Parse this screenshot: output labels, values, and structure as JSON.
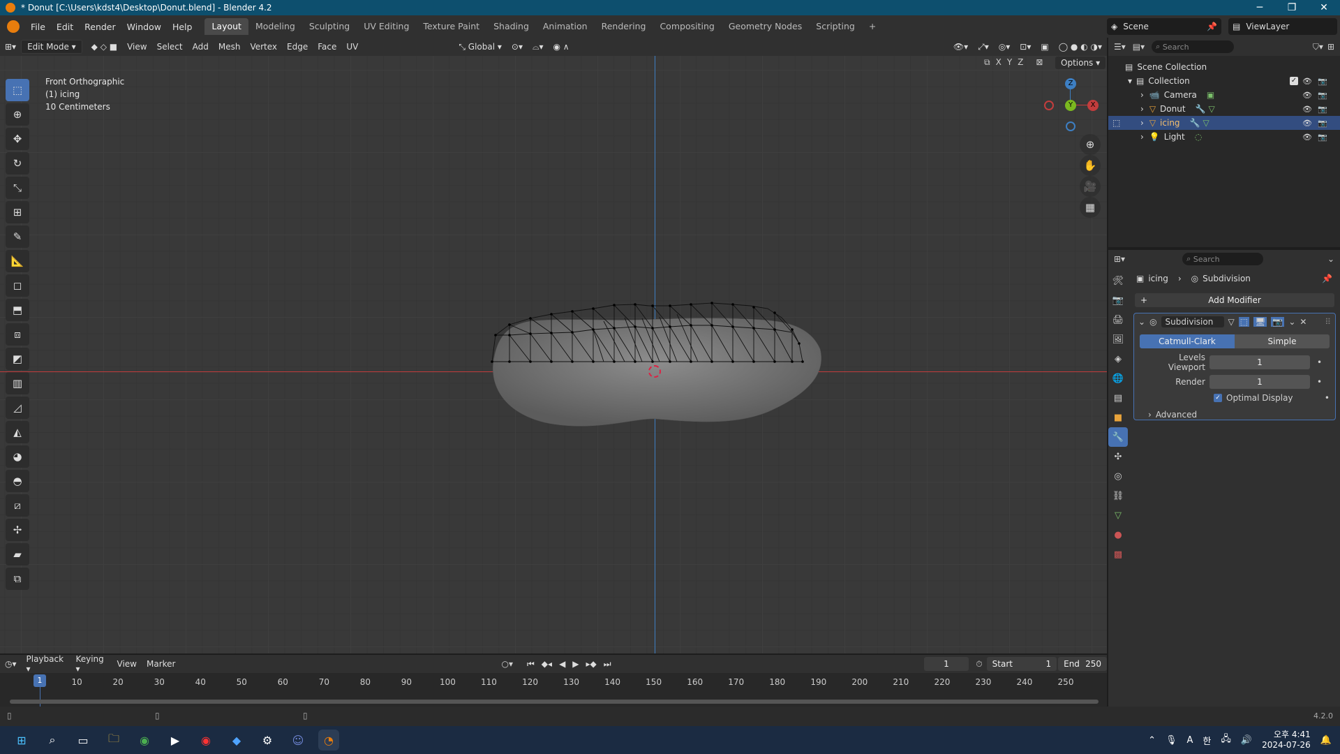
{
  "window": {
    "title": "* Donut [C:\\Users\\kdst4\\Desktop\\Donut.blend] - Blender 4.2",
    "minimize": "─",
    "restore": "❐",
    "close": "✕"
  },
  "menu": [
    "File",
    "Edit",
    "Render",
    "Window",
    "Help"
  ],
  "workspaces": [
    {
      "label": "Layout",
      "active": true
    },
    {
      "label": "Modeling"
    },
    {
      "label": "Sculpting"
    },
    {
      "label": "UV Editing"
    },
    {
      "label": "Texture Paint"
    },
    {
      "label": "Shading"
    },
    {
      "label": "Animation"
    },
    {
      "label": "Rendering"
    },
    {
      "label": "Compositing"
    },
    {
      "label": "Geometry Nodes"
    },
    {
      "label": "Scripting"
    }
  ],
  "add_workspace": "+",
  "scene": {
    "label": "Scene",
    "view_layer": "ViewLayer"
  },
  "viewport_header": {
    "mode": "Edit Mode",
    "menus": [
      "View",
      "Select",
      "Add",
      "Mesh",
      "Vertex",
      "Edge",
      "Face",
      "UV"
    ],
    "orientation": "Global",
    "options": "Options",
    "axes": [
      "X",
      "Y",
      "Z"
    ]
  },
  "overlay": {
    "view_name": "Front Orthographic",
    "object": "(1) icing",
    "scale": "10 Centimeters"
  },
  "gizmo": {
    "z": "Z",
    "y": "Y",
    "x": "X"
  },
  "outliner": {
    "search_placeholder": "Search",
    "scene_collection": "Scene Collection",
    "collection": "Collection",
    "items": [
      {
        "name": "Camera",
        "color": "#e8a33b",
        "selected": false
      },
      {
        "name": "Donut",
        "color": "#e8a33b",
        "selected": false
      },
      {
        "name": "icing",
        "color": "#e8a33b",
        "selected": true
      },
      {
        "name": "Light",
        "color": "#e8a33b",
        "selected": false
      }
    ]
  },
  "properties": {
    "search_placeholder": "Search",
    "breadcrumb_object": "icing",
    "breadcrumb_modifier": "Subdivision",
    "add_modifier": "Add Modifier",
    "modifier_name": "Subdivision",
    "tab_catmull": "Catmull-Clark",
    "tab_simple": "Simple",
    "levels_viewport_label": "Levels Viewport",
    "levels_viewport_value": "1",
    "render_label": "Render",
    "render_value": "1",
    "optimal_display": "Optimal Display",
    "advanced": "Advanced"
  },
  "timeline": {
    "menus": [
      "Playback",
      "Keying",
      "View",
      "Marker"
    ],
    "current_frame": "1",
    "start_label": "Start",
    "start": "1",
    "end_label": "End",
    "end": "250",
    "ticks": [
      "1",
      "10",
      "20",
      "30",
      "40",
      "50",
      "60",
      "70",
      "80",
      "90",
      "100",
      "110",
      "120",
      "130",
      "140",
      "150",
      "160",
      "170",
      "180",
      "190",
      "200",
      "210",
      "220",
      "230",
      "240",
      "250"
    ]
  },
  "status": {
    "version": "4.2.0"
  },
  "taskbar": {
    "time": "오후 4:41",
    "date": "2024-07-26",
    "ime": "A",
    "lang": "한"
  },
  "colors": {
    "accent": "#4772b3",
    "selection": "#334d80",
    "x_axis": "#c33d3d",
    "y_axis": "#7bb81f",
    "z_axis": "#3d7fc3"
  }
}
